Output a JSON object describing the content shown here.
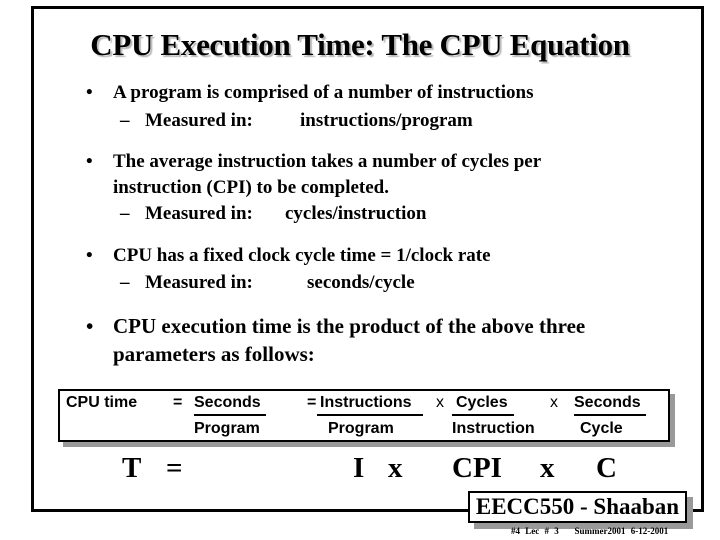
{
  "slide": {
    "title": "CPU Execution Time: The CPU Equation",
    "bullets": [
      {
        "text": "A program is comprised of a number of instructions",
        "sub": {
          "label": "Measured in:",
          "value": "instructions/program"
        }
      },
      {
        "text_line1": "The average instruction takes a number of cycles per",
        "text_line2": "instruction (CPI) to be completed.",
        "sub": {
          "label": "Measured in:",
          "value": "cycles/instruction"
        }
      },
      {
        "text": "CPU has a fixed clock cycle time = 1/clock rate",
        "sub": {
          "label": "Measured in:",
          "value": "seconds/cycle"
        }
      },
      {
        "text_line1": "CPU execution time is the product of the above three",
        "text_line2": "parameters as follows:"
      }
    ],
    "bullet_glyph": "•",
    "dash_glyph": "–",
    "equation": {
      "lhs": "CPU time",
      "eq1": "=",
      "frac1": {
        "num": "Seconds",
        "den": "Program"
      },
      "eq2": "=",
      "frac2": {
        "num": "Instructions",
        "den": "Program"
      },
      "times1": "x",
      "frac3": {
        "num": "Cycles",
        "den": "Instruction"
      },
      "times2": "x",
      "frac4": {
        "num": "Seconds",
        "den": "Cycle"
      }
    },
    "short_equation": {
      "T": "T",
      "eq": "=",
      "I": "I",
      "x1": "x",
      "CPI": "CPI",
      "x2": "x",
      "C": "C"
    },
    "footer": {
      "label": "EECC550 - Shaaban",
      "slide_no": "#4",
      "lecture": "Lec # 3",
      "term": "Summer2001",
      "date": "6-12-2001"
    }
  }
}
